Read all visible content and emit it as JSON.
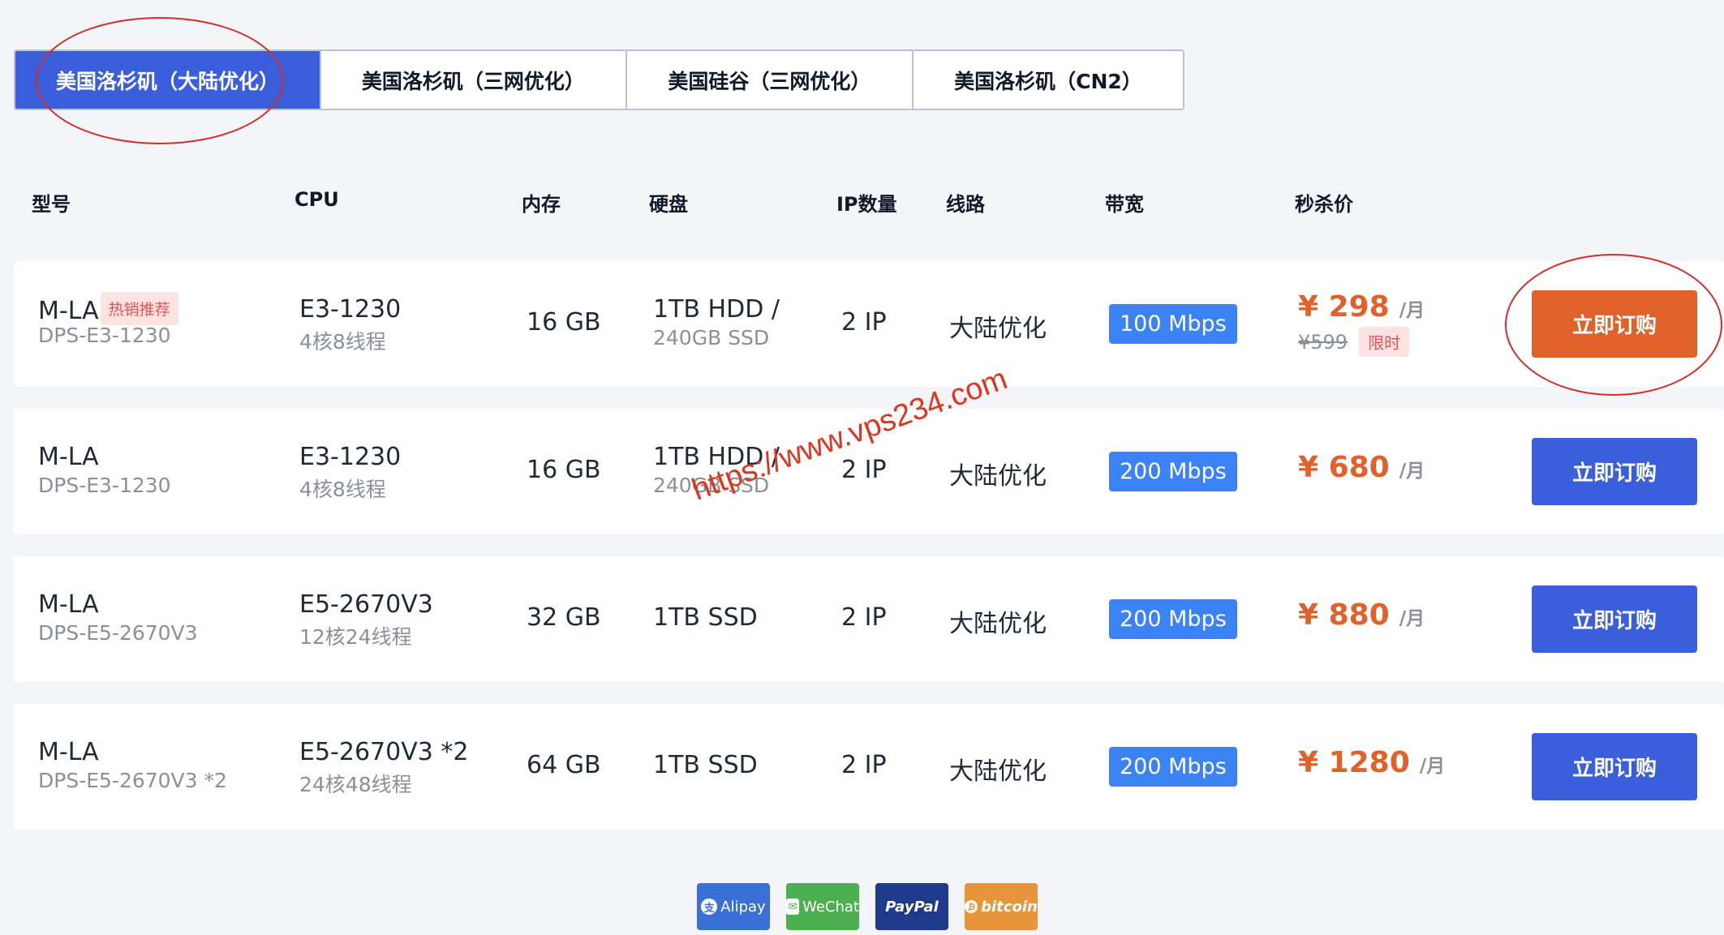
{
  "tabs": [
    {
      "label": "美国洛杉矶（大陆优化）",
      "active": true
    },
    {
      "label": "美国洛杉矶（三网优化）",
      "active": false
    },
    {
      "label": "美国硅谷（三网优化）",
      "active": false
    },
    {
      "label": "美国洛杉矶（CN2）",
      "active": false
    }
  ],
  "table": {
    "headers": {
      "model": "型号",
      "cpu": "CPU",
      "memory": "内存",
      "disk": "硬盘",
      "ip": "IP数量",
      "line": "线路",
      "bandwidth": "带宽",
      "price": "秒杀价"
    },
    "rows": [
      {
        "model": "M-LA",
        "model_sub": "DPS-E3-1230",
        "hot_badge": "热销推荐",
        "cpu": "E3-1230",
        "cpu_sub": "4核8线程",
        "memory": "16 GB",
        "disk": "1TB HDD /",
        "disk_sub": "240GB SSD",
        "ip": "2 IP",
        "line": "大陆优化",
        "bandwidth": "100 Mbps",
        "price": "¥ 298",
        "unit": "/月",
        "old_price": "¥599",
        "limit_badge": "限时",
        "button": "立即订购"
      },
      {
        "model": "M-LA",
        "model_sub": "DPS-E3-1230",
        "cpu": "E3-1230",
        "cpu_sub": "4核8线程",
        "memory": "16 GB",
        "disk": "1TB HDD /",
        "disk_sub": "240GB SSD",
        "ip": "2 IP",
        "line": "大陆优化",
        "bandwidth": "200 Mbps",
        "price": "¥ 680",
        "unit": "/月",
        "button": "立即订购"
      },
      {
        "model": "M-LA",
        "model_sub": "DPS-E5-2670V3",
        "cpu": "E5-2670V3",
        "cpu_sub": "12核24线程",
        "memory": "32 GB",
        "disk": "1TB SSD",
        "ip": "2 IP",
        "line": "大陆优化",
        "bandwidth": "200 Mbps",
        "price": "¥ 880",
        "unit": "/月",
        "button": "立即订购"
      },
      {
        "model": "M-LA",
        "model_sub": "DPS-E5-2670V3 *2",
        "cpu": "E5-2670V3 *2",
        "cpu_sub": "24核48线程",
        "memory": "64 GB",
        "disk": "1TB SSD",
        "ip": "2 IP",
        "line": "大陆优化",
        "bandwidth": "200 Mbps",
        "price": "¥ 1280",
        "unit": "/月",
        "button": "立即订购"
      }
    ]
  },
  "watermark": "https://www.vps234.com",
  "payments": [
    {
      "label": "Alipay",
      "color": "#3b6fd8"
    },
    {
      "label": "WeChat",
      "color": "#4caf50"
    },
    {
      "label": "PayPal",
      "color": "#1f3a8a"
    },
    {
      "label": "bitcoin",
      "color": "#e8943a"
    }
  ],
  "colors": {
    "accent": "#3b5fdc",
    "price": "#e0622a",
    "badge_bg": "#fde2e2",
    "badge_text": "#e05555",
    "bandwidth": "#3b82f6",
    "annotation": "#d62b2b"
  }
}
